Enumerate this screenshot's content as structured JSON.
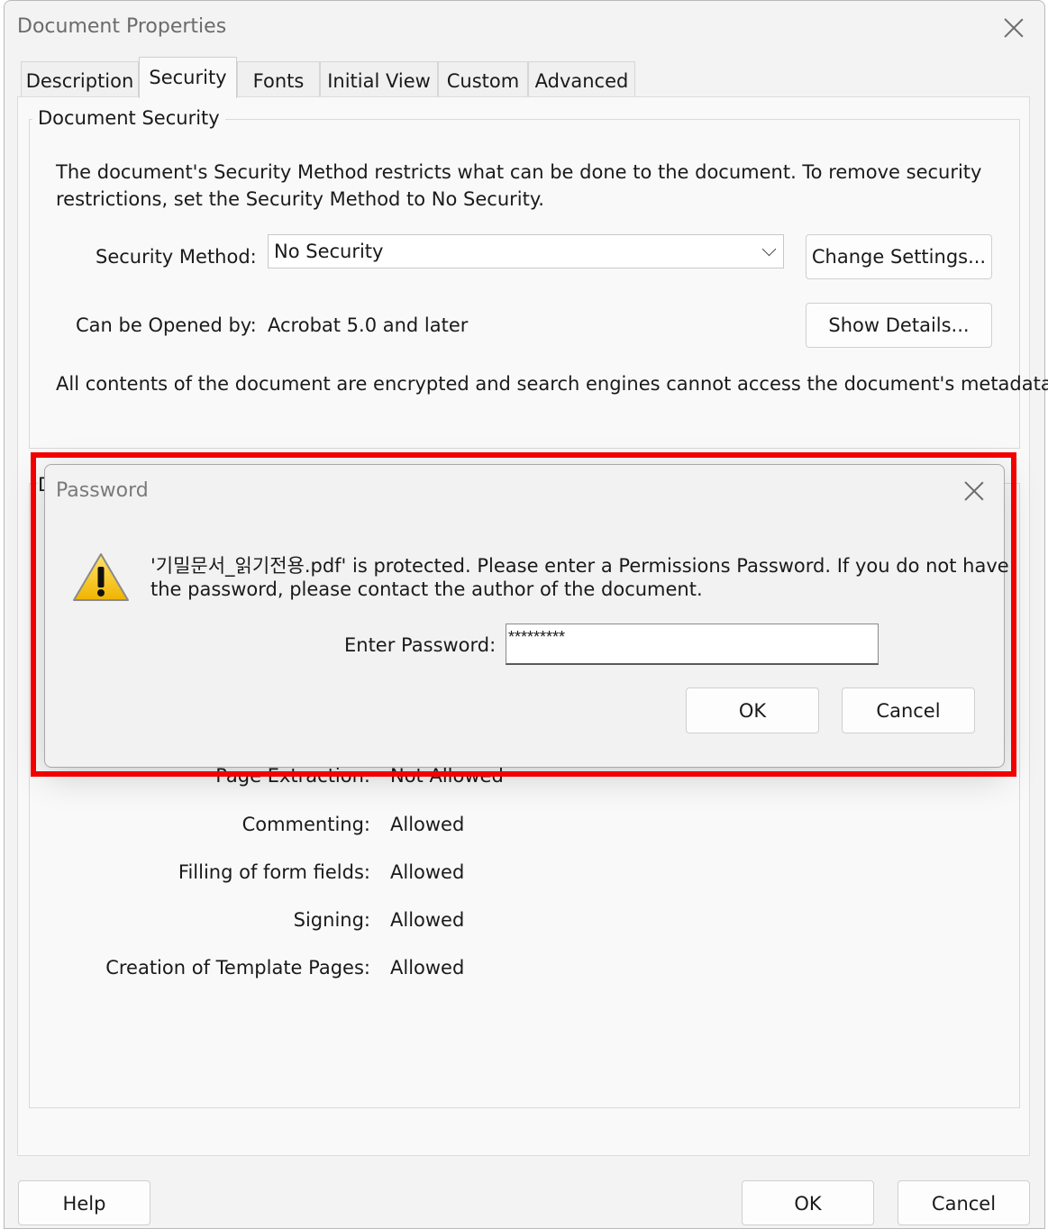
{
  "window": {
    "title": "Document Properties"
  },
  "tabs": [
    {
      "label": "Description"
    },
    {
      "label": "Security"
    },
    {
      "label": "Fonts"
    },
    {
      "label": "Initial View"
    },
    {
      "label": "Custom"
    },
    {
      "label": "Advanced"
    }
  ],
  "active_tab": "Security",
  "security": {
    "group_title": "Document Security",
    "intro_line1": "The document's Security Method restricts what can be done to the document. To remove security",
    "intro_line2": "restrictions, set the Security Method to No Security.",
    "method_label": "Security Method:",
    "method_value": "No Security",
    "change_settings_button": "Change Settings...",
    "opened_by_label": "Can be Opened by:",
    "opened_by_value": "Acrobat 5.0 and later",
    "show_details_button": "Show Details...",
    "encryption_note": "All contents of the document are encrypted and search engines cannot access the document's metadata."
  },
  "restrictions": {
    "partial_group_letter": "D",
    "items": [
      {
        "label": "Page Extraction:",
        "value": "Not Allowed"
      },
      {
        "label": "Commenting:",
        "value": "Allowed"
      },
      {
        "label": "Filling of form fields:",
        "value": "Allowed"
      },
      {
        "label": "Signing:",
        "value": "Allowed"
      },
      {
        "label": "Creation of Template Pages:",
        "value": "Allowed"
      }
    ]
  },
  "footer": {
    "help_button": "Help",
    "ok_button": "OK",
    "cancel_button": "Cancel"
  },
  "password_dialog": {
    "title": "Password",
    "message_line1": "'기밀문서_읽기전용.pdf' is protected. Please enter a Permissions Password. If you do not have",
    "message_line2": "the password, please contact the author of the document.",
    "password_label": "Enter Password:",
    "password_value": "*********",
    "ok_button": "OK",
    "cancel_button": "Cancel",
    "highlight_color": "#f20000",
    "icon": "warning-icon"
  }
}
